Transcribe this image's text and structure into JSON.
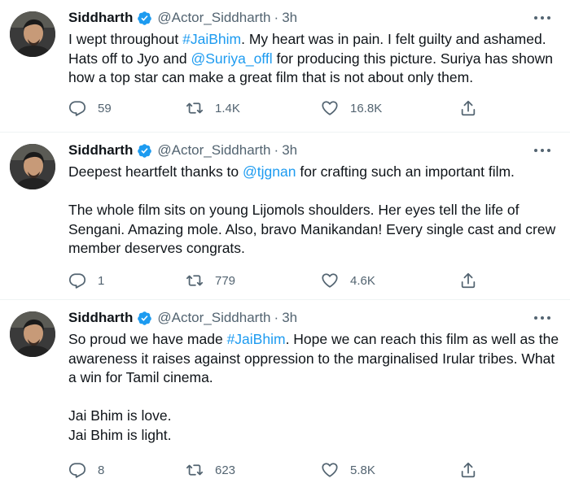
{
  "colors": {
    "link": "#1d9bf0",
    "text": "#0f1419",
    "muted": "#536471",
    "verified": "#1d9bf0"
  },
  "icons": [
    "avatar",
    "verified-badge-icon",
    "more-icon",
    "reply-icon",
    "retweet-icon",
    "like-icon",
    "share-icon"
  ],
  "tweets": [
    {
      "name": "Siddharth",
      "handle": "@Actor_Siddharth",
      "dot": "·",
      "time": "3h",
      "lines": {
        "l1a": "I wept throughout ",
        "l1link": "#JaiBhim",
        "l1b": ". My heart was in pain. I felt guilty and ashamed. Hats off to Jyo and ",
        "l1link2": "@Suriya_offl",
        "l1c": " for producing this picture. Suriya has shown how a top star can make a great film that is not about only them."
      },
      "replies": "59",
      "retweets": "1.4K",
      "likes": "16.8K"
    },
    {
      "name": "Siddharth",
      "handle": "@Actor_Siddharth",
      "dot": "·",
      "time": "3h",
      "lines": {
        "p1a": "Deepest heartfelt thanks to ",
        "p1link": "@tjgnan",
        "p1b": " for crafting such an important film.",
        "p2": "The whole film sits on young Lijomols shoulders. Her eyes tell the life of Sengani. Amazing mole. Also, bravo Manikandan! Every single cast and crew member deserves congrats."
      },
      "replies": "1",
      "retweets": "779",
      "likes": "4.6K"
    },
    {
      "name": "Siddharth",
      "handle": "@Actor_Siddharth",
      "dot": "·",
      "time": "3h",
      "lines": {
        "p1a": "So proud we have made ",
        "p1link": "#JaiBhim",
        "p1b": ". Hope we can reach this film as well as the awareness it raises against oppression to the marginalised Irular tribes. What a win for Tamil cinema.",
        "p2": "Jai Bhim is love.",
        "p3": "Jai Bhim is light."
      },
      "replies": "8",
      "retweets": "623",
      "likes": "5.8K"
    }
  ]
}
